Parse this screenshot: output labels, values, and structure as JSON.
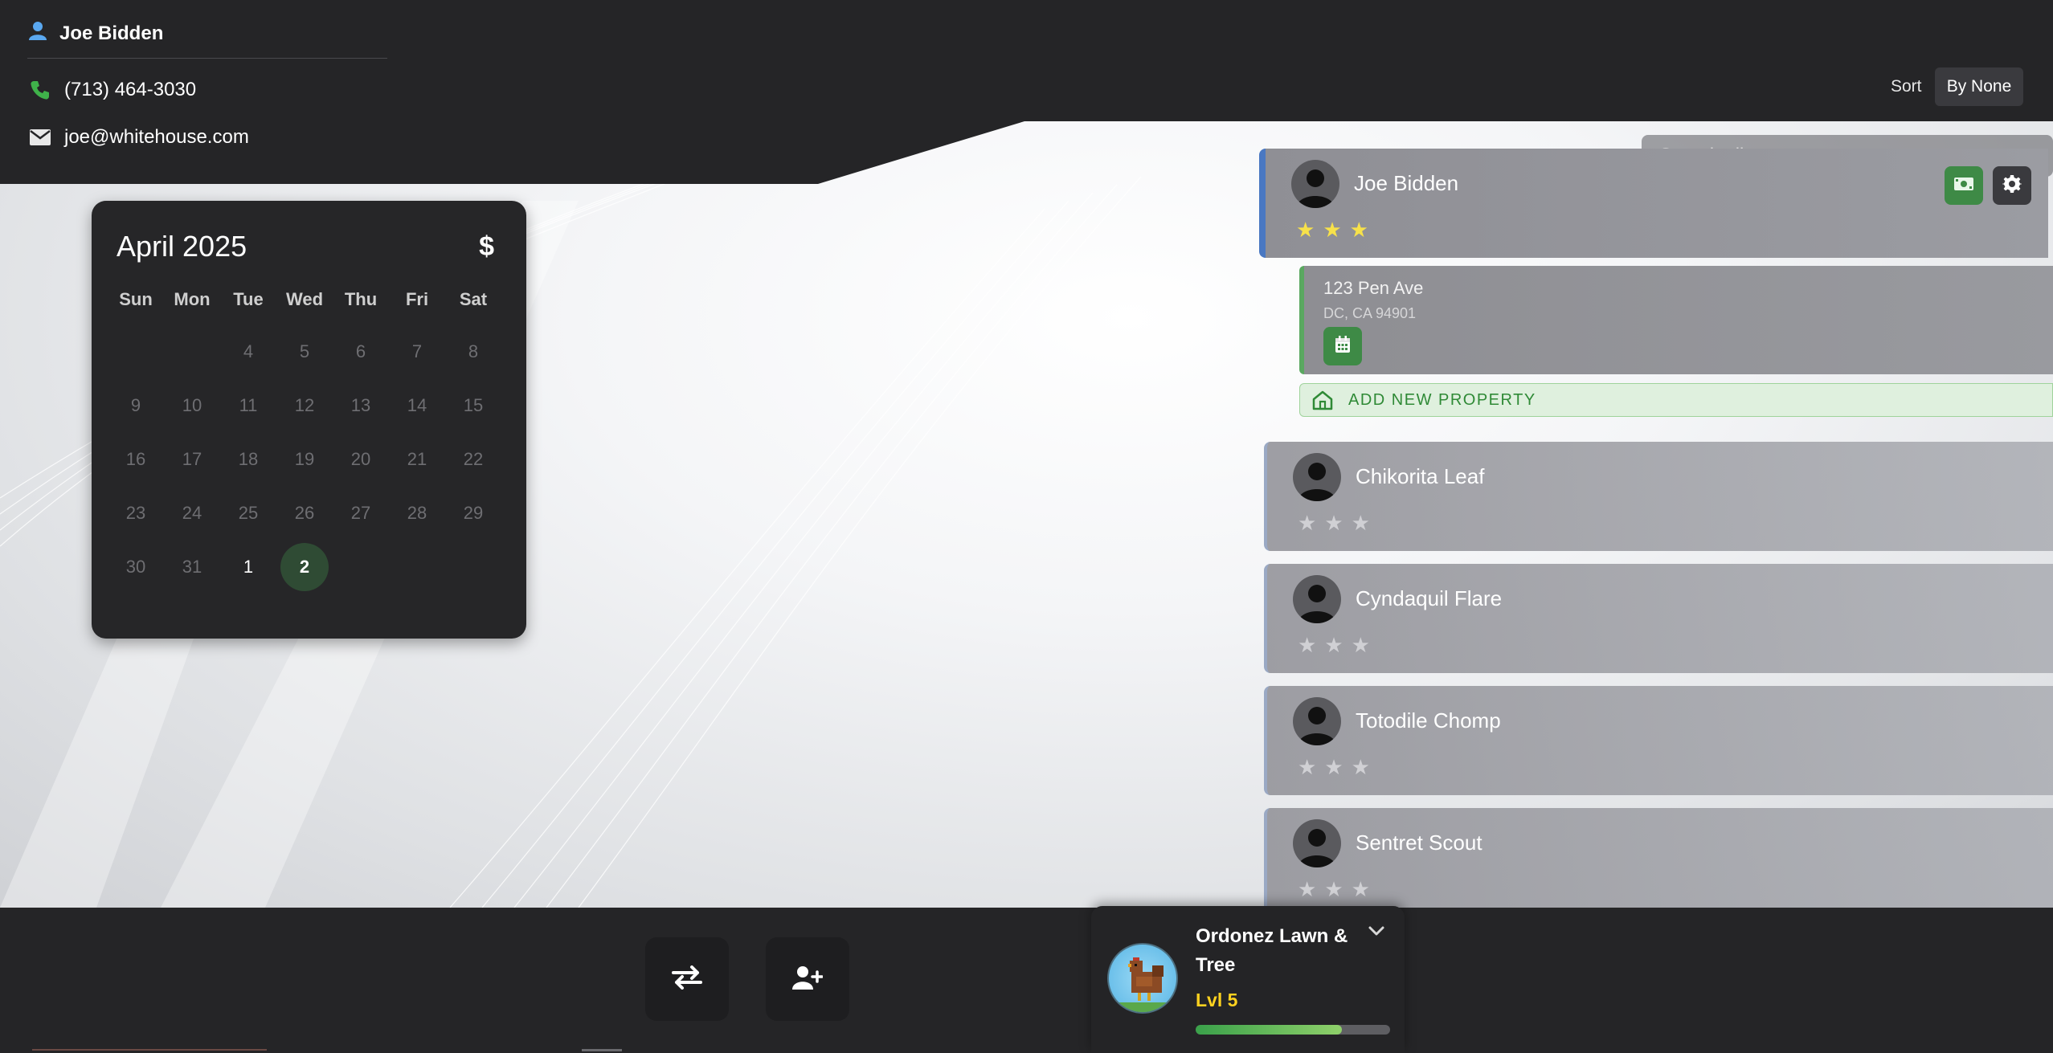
{
  "header": {
    "client_name": "Joe Bidden",
    "phone": "(713) 464-3030",
    "email": "joe@whitehouse.com",
    "sort_label": "Sort",
    "sort_value": "By None"
  },
  "calendar": {
    "title": "April 2025",
    "currency_symbol": "$",
    "weekdays": [
      "Sun",
      "Mon",
      "Tue",
      "Wed",
      "Thu",
      "Fri",
      "Sat"
    ],
    "weeks": [
      [
        "",
        "",
        "4",
        "5",
        "6",
        "7",
        "8"
      ],
      [
        "9",
        "10",
        "11",
        "12",
        "13",
        "14",
        "15"
      ],
      [
        "16",
        "17",
        "18",
        "19",
        "20",
        "21",
        "22"
      ],
      [
        "23",
        "24",
        "25",
        "26",
        "27",
        "28",
        "29"
      ],
      [
        "30",
        "31",
        "1",
        "2",
        "",
        "",
        ""
      ]
    ],
    "current_days": [
      "1",
      "2"
    ],
    "today": "2"
  },
  "search": {
    "placeholder": "Search clients..."
  },
  "clients": [
    {
      "name": "Joe Bidden",
      "rating": 3,
      "max_rating": 5,
      "active": true
    },
    {
      "name": "Chikorita Leaf",
      "rating": 0,
      "max_rating": 3,
      "active": false
    },
    {
      "name": "Cyndaquil Flare",
      "rating": 0,
      "max_rating": 3,
      "active": false
    },
    {
      "name": "Totodile Chomp",
      "rating": 0,
      "max_rating": 3,
      "active": false
    },
    {
      "name": "Sentret Scout",
      "rating": 0,
      "max_rating": 3,
      "active": false
    }
  ],
  "property": {
    "street": "123 Pen Ave",
    "city_line": "DC, CA 94901",
    "add_label": "ADD NEW PROPERTY"
  },
  "company": {
    "name": "Ordonez Lawn & Tree",
    "level": "Lvl 5",
    "xp_fraction": 0.75
  },
  "icons": {
    "user": "user-icon",
    "phone": "phone-icon",
    "email": "envelope-icon",
    "money": "money-icon",
    "gear": "gear-icon",
    "calendar": "calendar-icon",
    "house": "house-icon",
    "swap": "swap-icon",
    "add_user": "add-user-icon",
    "chevron": "chevron-down-icon"
  },
  "colors": {
    "accent_blue": "#4a78c2",
    "accent_green": "#3e8a46",
    "today_circle": "#2f4b34",
    "level_gold": "#ffd21f",
    "star_gold": "#f7e14a"
  }
}
